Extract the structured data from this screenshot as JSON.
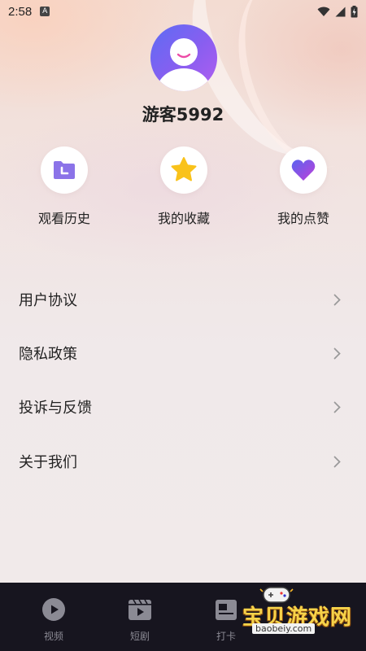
{
  "status_bar": {
    "time": "2:58",
    "notification_icon": "A"
  },
  "profile": {
    "username": "游客5992"
  },
  "actions": [
    {
      "label": "观看历史",
      "icon": "history-folder-icon"
    },
    {
      "label": "我的收藏",
      "icon": "star-icon"
    },
    {
      "label": "我的点赞",
      "icon": "heart-icon"
    }
  ],
  "menu": [
    {
      "label": "用户协议"
    },
    {
      "label": "隐私政策"
    },
    {
      "label": "投诉与反馈"
    },
    {
      "label": "关于我们"
    }
  ],
  "tabbar": [
    {
      "label": "视频",
      "icon": "play-circle-icon"
    },
    {
      "label": "短剧",
      "icon": "clapper-icon"
    },
    {
      "label": "打卡",
      "icon": "checkin-icon"
    }
  ],
  "watermark": {
    "title": "宝贝游戏网",
    "url": "baobeiy.com"
  },
  "colors": {
    "accent_purple": "#8a5ef0",
    "star_yellow": "#f9c21a",
    "tabbar_bg": "#17151f"
  }
}
